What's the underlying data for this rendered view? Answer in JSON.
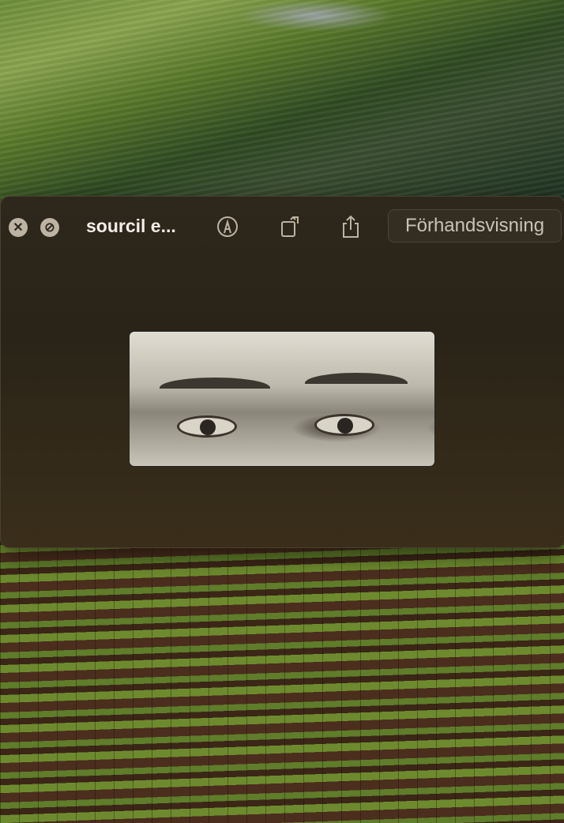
{
  "window": {
    "title": "sourcil e...",
    "open_with_label": "Förhandsvisning",
    "icons": [
      "close-icon",
      "fullscreen-icon",
      "markup-icon",
      "rotate-icon",
      "share-icon"
    ]
  }
}
